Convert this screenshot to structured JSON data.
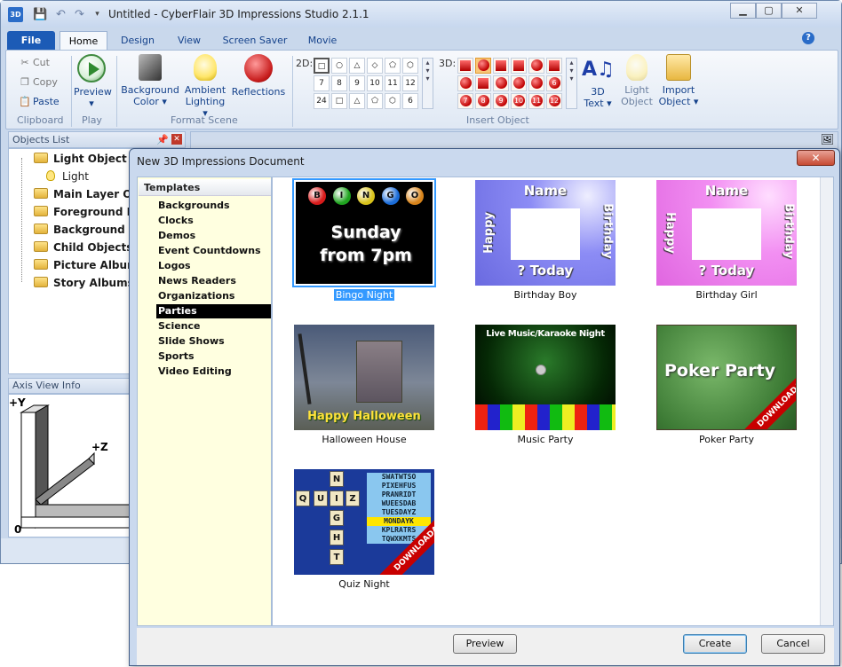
{
  "app": {
    "title": "Untitled - CyberFlair 3D Impressions Studio 2.1.1",
    "logo": "3D",
    "window_buttons": [
      "▁",
      "▢",
      "✕"
    ]
  },
  "tabs": [
    "File",
    "Home",
    "Design",
    "View",
    "Screen Saver",
    "Movie"
  ],
  "help": "?",
  "ribbon": {
    "clipboard": {
      "cut": "Cut",
      "copy": "Copy",
      "paste": "Paste",
      "label": "Clipboard"
    },
    "play": {
      "preview": "Preview",
      "arrow": "▾",
      "label": "Play"
    },
    "format": {
      "bg_color": "Background",
      "bg_color2": "Color ▾",
      "ambient": "Ambient",
      "ambient2": "Lighting ▾",
      "reflections": "Reflections",
      "label": "Format Scene"
    },
    "shapes2d_label": "2D:",
    "shapes2d": [
      "□",
      "○",
      "△",
      "◇",
      "⬠",
      "⬡",
      "7",
      "8",
      "9",
      "10",
      "11",
      "12",
      "24",
      "□",
      "△",
      "⬠",
      "⬡",
      "6"
    ],
    "shapes3d_label": "3D:",
    "shapes3d": [
      "",
      "",
      "",
      "",
      "",
      "",
      "",
      "",
      "",
      "",
      "",
      "6",
      "7",
      "8",
      "9",
      "10",
      "11",
      "12"
    ],
    "text3d": "3D",
    "text3d2": "Text ▾",
    "light_obj": "Light",
    "light_obj2": "Object",
    "import_obj": "Import",
    "import_obj2": "Object ▾",
    "insert_label": "Insert Object"
  },
  "objects_panel": {
    "title": "Objects List",
    "items": [
      {
        "label": "Light Object",
        "icon": "folder"
      },
      {
        "label": "Light",
        "icon": "bulb"
      },
      {
        "label": "Main Layer Obje",
        "icon": "folder"
      },
      {
        "label": "Foreground Lay",
        "icon": "folder"
      },
      {
        "label": "Background Lay",
        "icon": "folder"
      },
      {
        "label": "Child Objects",
        "icon": "folder"
      },
      {
        "label": "Picture Albums",
        "icon": "folder"
      },
      {
        "label": "Story Albums",
        "icon": "folder"
      }
    ]
  },
  "axis_panel": {
    "title": "Axis View Info",
    "y": "+Y",
    "z": "+Z",
    "origin": "0"
  },
  "dialog": {
    "title": "New 3D Impressions Document",
    "close": "✕",
    "templates_header": "Templates",
    "categories": [
      "Backgrounds",
      "Clocks",
      "Demos",
      "Event Countdowns",
      "Logos",
      "News Readers",
      "Organizations",
      "Parties",
      "Science",
      "Slide Shows",
      "Sports",
      "Video Editing"
    ],
    "selected_category": "Parties",
    "templates": [
      {
        "caption": "Bingo Night",
        "selected": true
      },
      {
        "caption": "Birthday Boy",
        "selected": false
      },
      {
        "caption": "Birthday Girl",
        "selected": false
      },
      {
        "caption": "Halloween House",
        "selected": false
      },
      {
        "caption": "Music Party",
        "selected": false
      },
      {
        "caption": "Poker Party",
        "selected": false
      },
      {
        "caption": "Quiz Night",
        "selected": false
      }
    ],
    "thumb_text": {
      "bingo_letters": [
        "B",
        "I",
        "N",
        "G",
        "O"
      ],
      "bingo_line1": "Sunday",
      "bingo_line2": "from 7pm",
      "bday_name": "Name",
      "bday_happy": "Happy",
      "bday_birthday": "Birthday",
      "bday_today": "? Today",
      "halloween": "Happy Halloween",
      "music": "Live Music/Karaoke Night",
      "poker": "Poker Party",
      "downloadable": "DOWNLOADABLE",
      "quiz_letters": [
        "N",
        "Q",
        "U",
        "I",
        "Z",
        "G",
        "H",
        "T"
      ],
      "quiz_grid": [
        "SWATWTSO",
        "PIXEHFUS",
        "PRANRIDT",
        "WUEESDAB",
        "TUESDAYZ",
        "MONDAYK",
        "KPLRATRS",
        "TQWXKMTS"
      ]
    },
    "buttons": {
      "preview": "Preview",
      "create": "Create",
      "cancel": "Cancel"
    }
  }
}
